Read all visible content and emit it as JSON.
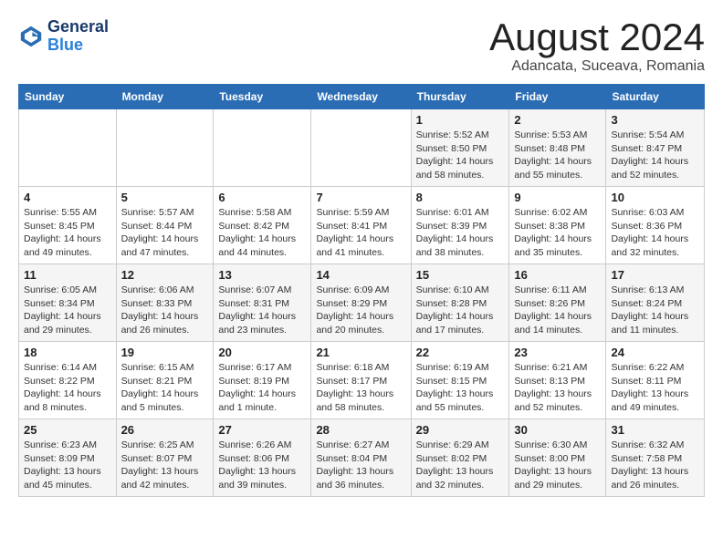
{
  "header": {
    "logo_line1": "General",
    "logo_line2": "Blue",
    "month_title": "August 2024",
    "location": "Adancata, Suceava, Romania"
  },
  "weekdays": [
    "Sunday",
    "Monday",
    "Tuesday",
    "Wednesday",
    "Thursday",
    "Friday",
    "Saturday"
  ],
  "weeks": [
    [
      {
        "day": "",
        "info": ""
      },
      {
        "day": "",
        "info": ""
      },
      {
        "day": "",
        "info": ""
      },
      {
        "day": "",
        "info": ""
      },
      {
        "day": "1",
        "info": "Sunrise: 5:52 AM\nSunset: 8:50 PM\nDaylight: 14 hours\nand 58 minutes."
      },
      {
        "day": "2",
        "info": "Sunrise: 5:53 AM\nSunset: 8:48 PM\nDaylight: 14 hours\nand 55 minutes."
      },
      {
        "day": "3",
        "info": "Sunrise: 5:54 AM\nSunset: 8:47 PM\nDaylight: 14 hours\nand 52 minutes."
      }
    ],
    [
      {
        "day": "4",
        "info": "Sunrise: 5:55 AM\nSunset: 8:45 PM\nDaylight: 14 hours\nand 49 minutes."
      },
      {
        "day": "5",
        "info": "Sunrise: 5:57 AM\nSunset: 8:44 PM\nDaylight: 14 hours\nand 47 minutes."
      },
      {
        "day": "6",
        "info": "Sunrise: 5:58 AM\nSunset: 8:42 PM\nDaylight: 14 hours\nand 44 minutes."
      },
      {
        "day": "7",
        "info": "Sunrise: 5:59 AM\nSunset: 8:41 PM\nDaylight: 14 hours\nand 41 minutes."
      },
      {
        "day": "8",
        "info": "Sunrise: 6:01 AM\nSunset: 8:39 PM\nDaylight: 14 hours\nand 38 minutes."
      },
      {
        "day": "9",
        "info": "Sunrise: 6:02 AM\nSunset: 8:38 PM\nDaylight: 14 hours\nand 35 minutes."
      },
      {
        "day": "10",
        "info": "Sunrise: 6:03 AM\nSunset: 8:36 PM\nDaylight: 14 hours\nand 32 minutes."
      }
    ],
    [
      {
        "day": "11",
        "info": "Sunrise: 6:05 AM\nSunset: 8:34 PM\nDaylight: 14 hours\nand 29 minutes."
      },
      {
        "day": "12",
        "info": "Sunrise: 6:06 AM\nSunset: 8:33 PM\nDaylight: 14 hours\nand 26 minutes."
      },
      {
        "day": "13",
        "info": "Sunrise: 6:07 AM\nSunset: 8:31 PM\nDaylight: 14 hours\nand 23 minutes."
      },
      {
        "day": "14",
        "info": "Sunrise: 6:09 AM\nSunset: 8:29 PM\nDaylight: 14 hours\nand 20 minutes."
      },
      {
        "day": "15",
        "info": "Sunrise: 6:10 AM\nSunset: 8:28 PM\nDaylight: 14 hours\nand 17 minutes."
      },
      {
        "day": "16",
        "info": "Sunrise: 6:11 AM\nSunset: 8:26 PM\nDaylight: 14 hours\nand 14 minutes."
      },
      {
        "day": "17",
        "info": "Sunrise: 6:13 AM\nSunset: 8:24 PM\nDaylight: 14 hours\nand 11 minutes."
      }
    ],
    [
      {
        "day": "18",
        "info": "Sunrise: 6:14 AM\nSunset: 8:22 PM\nDaylight: 14 hours\nand 8 minutes."
      },
      {
        "day": "19",
        "info": "Sunrise: 6:15 AM\nSunset: 8:21 PM\nDaylight: 14 hours\nand 5 minutes."
      },
      {
        "day": "20",
        "info": "Sunrise: 6:17 AM\nSunset: 8:19 PM\nDaylight: 14 hours\nand 1 minute."
      },
      {
        "day": "21",
        "info": "Sunrise: 6:18 AM\nSunset: 8:17 PM\nDaylight: 13 hours\nand 58 minutes."
      },
      {
        "day": "22",
        "info": "Sunrise: 6:19 AM\nSunset: 8:15 PM\nDaylight: 13 hours\nand 55 minutes."
      },
      {
        "day": "23",
        "info": "Sunrise: 6:21 AM\nSunset: 8:13 PM\nDaylight: 13 hours\nand 52 minutes."
      },
      {
        "day": "24",
        "info": "Sunrise: 6:22 AM\nSunset: 8:11 PM\nDaylight: 13 hours\nand 49 minutes."
      }
    ],
    [
      {
        "day": "25",
        "info": "Sunrise: 6:23 AM\nSunset: 8:09 PM\nDaylight: 13 hours\nand 45 minutes."
      },
      {
        "day": "26",
        "info": "Sunrise: 6:25 AM\nSunset: 8:07 PM\nDaylight: 13 hours\nand 42 minutes."
      },
      {
        "day": "27",
        "info": "Sunrise: 6:26 AM\nSunset: 8:06 PM\nDaylight: 13 hours\nand 39 minutes."
      },
      {
        "day": "28",
        "info": "Sunrise: 6:27 AM\nSunset: 8:04 PM\nDaylight: 13 hours\nand 36 minutes."
      },
      {
        "day": "29",
        "info": "Sunrise: 6:29 AM\nSunset: 8:02 PM\nDaylight: 13 hours\nand 32 minutes."
      },
      {
        "day": "30",
        "info": "Sunrise: 6:30 AM\nSunset: 8:00 PM\nDaylight: 13 hours\nand 29 minutes."
      },
      {
        "day": "31",
        "info": "Sunrise: 6:32 AM\nSunset: 7:58 PM\nDaylight: 13 hours\nand 26 minutes."
      }
    ]
  ]
}
